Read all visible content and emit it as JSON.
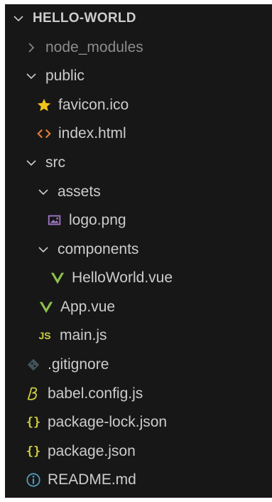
{
  "explorer": {
    "root": {
      "label": "HELLO-WORLD",
      "expanded": true
    },
    "items": [
      {
        "label": "node_modules",
        "kind": "folder",
        "expanded": false,
        "dimmed": true
      },
      {
        "label": "public",
        "kind": "folder",
        "expanded": true
      },
      {
        "label": "favicon.ico",
        "kind": "file",
        "icon": "star-icon"
      },
      {
        "label": "index.html",
        "kind": "file",
        "icon": "html-icon"
      },
      {
        "label": "src",
        "kind": "folder",
        "expanded": true
      },
      {
        "label": "assets",
        "kind": "folder",
        "expanded": true
      },
      {
        "label": "logo.png",
        "kind": "file",
        "icon": "image-icon"
      },
      {
        "label": "components",
        "kind": "folder",
        "expanded": true
      },
      {
        "label": "HelloWorld.vue",
        "kind": "file",
        "icon": "vue-icon"
      },
      {
        "label": "App.vue",
        "kind": "file",
        "icon": "vue-icon"
      },
      {
        "label": "main.js",
        "kind": "file",
        "icon": "js-icon",
        "icon_text": "JS"
      },
      {
        "label": ".gitignore",
        "kind": "file",
        "icon": "git-icon"
      },
      {
        "label": "babel.config.js",
        "kind": "file",
        "icon": "babel-icon"
      },
      {
        "label": "package-lock.json",
        "kind": "file",
        "icon": "json-icon",
        "icon_text": "{}"
      },
      {
        "label": "package.json",
        "kind": "file",
        "icon": "json-icon",
        "icon_text": "{}"
      },
      {
        "label": "README.md",
        "kind": "file",
        "icon": "info-icon"
      }
    ]
  },
  "colors": {
    "background": "#171717",
    "text": "#cccccc",
    "dimmed_text": "#8c8c8c",
    "star": "#f0c419",
    "html": "#e37933",
    "image": "#a074c4",
    "vue": "#8dc149",
    "js": "#cbcb41",
    "git": "#41535b",
    "babel": "#cbcb41",
    "json": "#cbcb41",
    "info": "#519aba"
  }
}
